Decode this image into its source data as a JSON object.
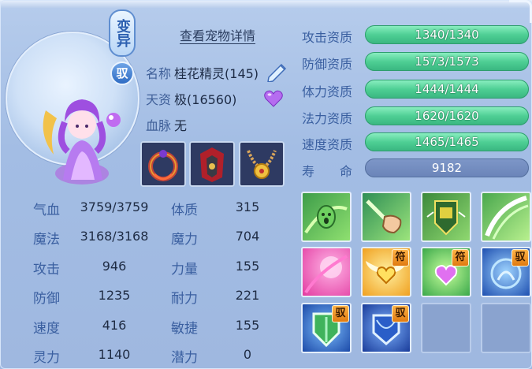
{
  "pet": {
    "badge_variant": "变异",
    "badge_ride": "驭",
    "detail_link": "查看宠物详情",
    "name_label": "名称",
    "name_value": "桂花精灵(145)",
    "talent_label": "天资",
    "talent_value": "极(16560)",
    "blood_label": "血脉",
    "blood_value": "无"
  },
  "stats": [
    {
      "label": "气血",
      "value": "3759/3759"
    },
    {
      "label": "魔法",
      "value": "3168/3168"
    },
    {
      "label": "攻击",
      "value": "946"
    },
    {
      "label": "防御",
      "value": "1235"
    },
    {
      "label": "速度",
      "value": "416"
    },
    {
      "label": "灵力",
      "value": "1140"
    }
  ],
  "attributes": [
    {
      "label": "体质",
      "value": "315"
    },
    {
      "label": "魔力",
      "value": "704"
    },
    {
      "label": "力量",
      "value": "155"
    },
    {
      "label": "耐力",
      "value": "221"
    },
    {
      "label": "敏捷",
      "value": "155"
    },
    {
      "label": "潜力",
      "value": "0"
    }
  ],
  "aptitudes": [
    {
      "label": "攻击资质",
      "value": "1340/1340"
    },
    {
      "label": "防御资质",
      "value": "1573/1573"
    },
    {
      "label": "体力资质",
      "value": "1444/1444"
    },
    {
      "label": "法力资质",
      "value": "1620/1620"
    },
    {
      "label": "速度资质",
      "value": "1465/1465"
    }
  ],
  "lifespan": {
    "label_a": "寿",
    "label_b": "命",
    "value": "9182"
  },
  "skill_tags": {
    "fu": "符",
    "yu": "驭"
  },
  "colors": {
    "aptitude_bar": "#4fcf95",
    "lifespan_bar": "#6a84b8",
    "label_blue": "#3a5fa0"
  }
}
